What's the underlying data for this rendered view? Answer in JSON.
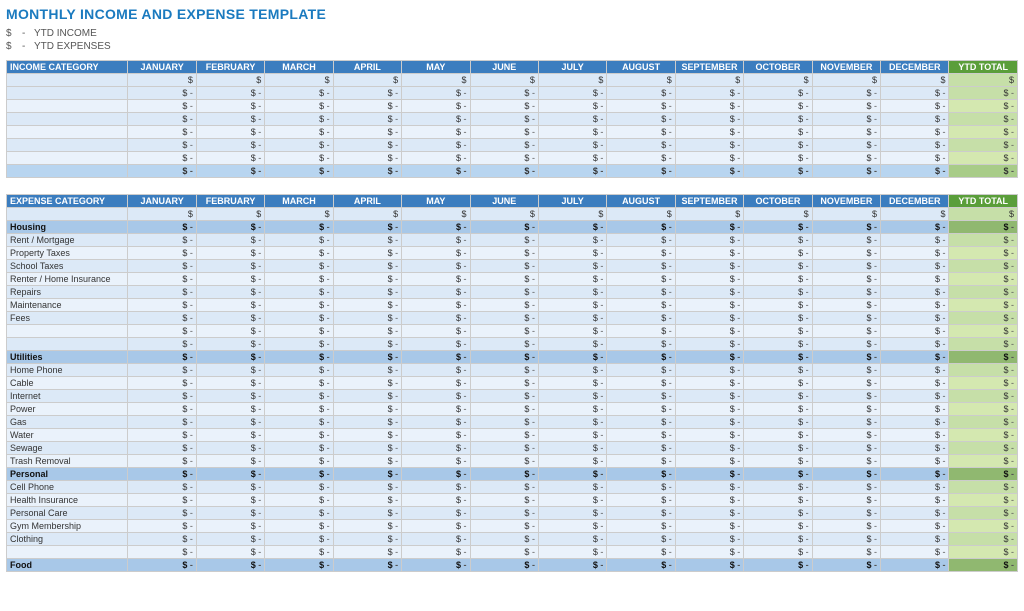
{
  "title": "MONTHLY INCOME AND EXPENSE TEMPLATE",
  "legend": {
    "income_label": "YTD INCOME",
    "expense_label": "YTD EXPENSES"
  },
  "months": [
    "JANUARY",
    "FEBRUARY",
    "MARCH",
    "APRIL",
    "MAY",
    "JUNE",
    "JULY",
    "AUGUST",
    "SEPTEMBER",
    "OCTOBER",
    "NOVEMBER",
    "DECEMBER"
  ],
  "ytd_label": "YTD TOTAL",
  "income": {
    "section_label": "INCOME CATEGORY",
    "rows": 8
  },
  "expense": {
    "section_label": "EXPENSE CATEGORY",
    "categories": [
      {
        "name": "Housing",
        "items": [
          "Rent / Mortgage",
          "Property Taxes",
          "School Taxes",
          "Renter / Home Insurance",
          "Repairs",
          "Maintenance",
          "Fees"
        ]
      },
      {
        "name": "Utilities",
        "items": [
          "Home Phone",
          "Cable",
          "Internet",
          "Power",
          "Gas",
          "Water",
          "Sewage",
          "Trash Removal"
        ]
      },
      {
        "name": "Personal",
        "items": [
          "Cell Phone",
          "Health Insurance",
          "Personal Care",
          "Gym Membership",
          "Clothing"
        ]
      },
      {
        "name": "Food",
        "items": []
      }
    ]
  }
}
